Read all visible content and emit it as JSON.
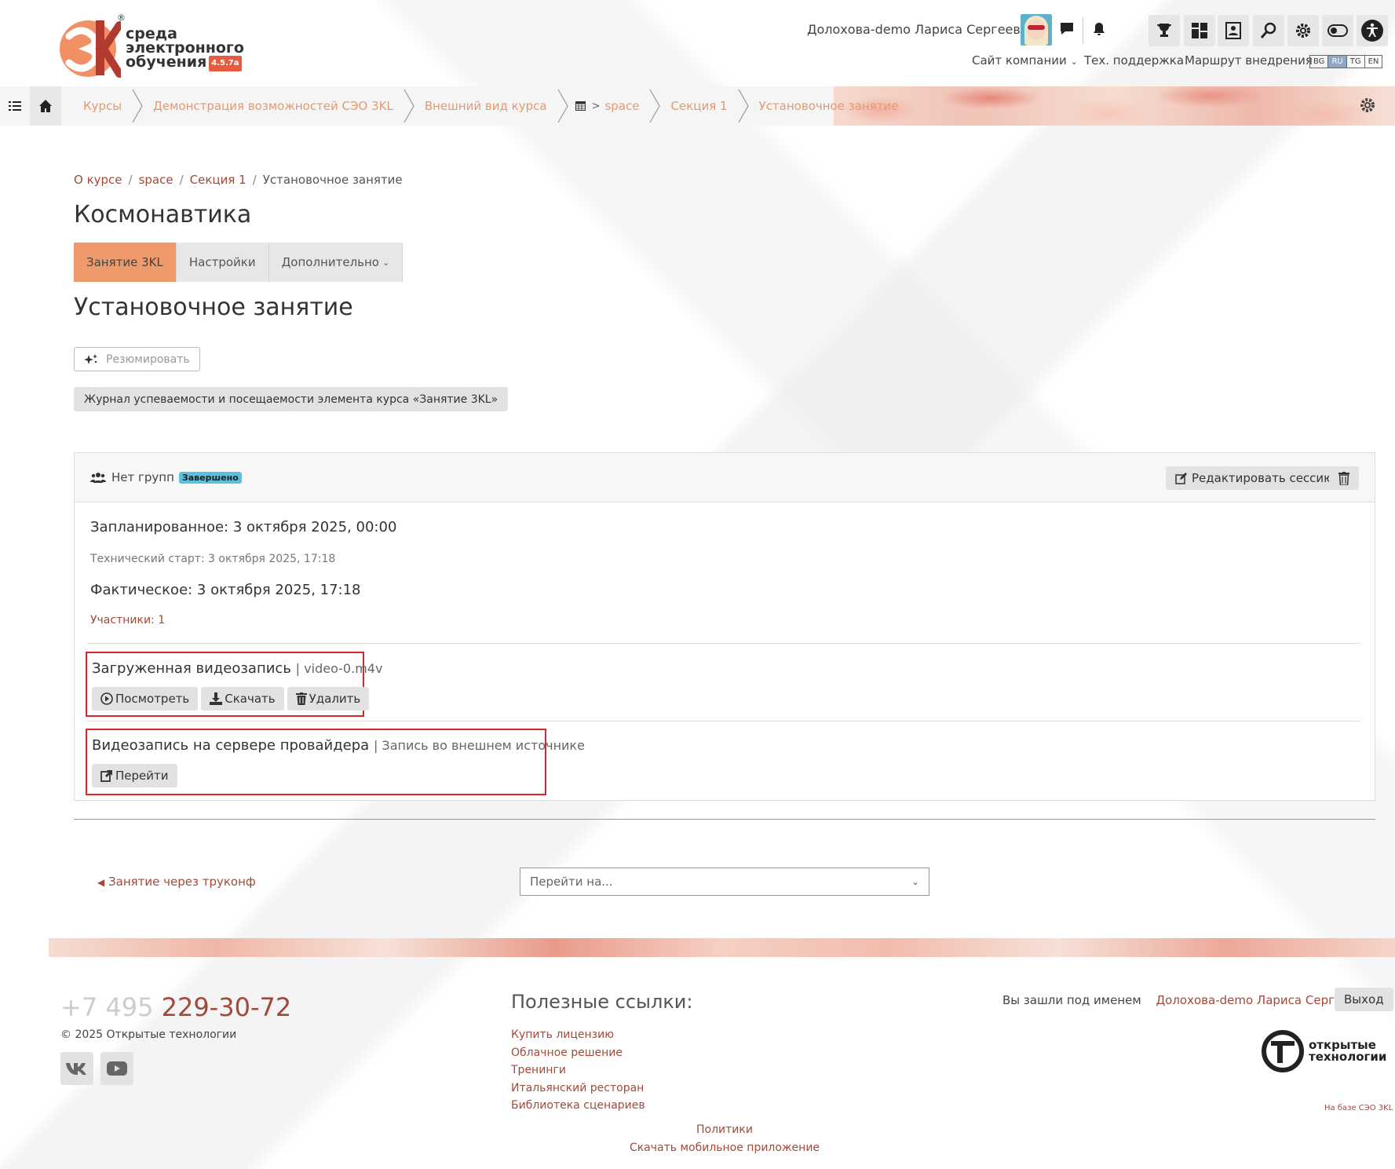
{
  "logo": {
    "line1": "среда",
    "line2": "электронного",
    "line3": "обучения",
    "version": "4.5.7a",
    "reg": "®"
  },
  "header": {
    "user_name": "Долохова-demo Лариса Сергеевна",
    "nav": {
      "company_site": "Сайт компании",
      "support": "Тех. поддержка",
      "route": "Маршрут внедрения"
    },
    "langs": [
      "BG",
      "RU",
      "TG",
      "EN"
    ],
    "active_lang": "RU"
  },
  "breadcrumb_bar": {
    "items": [
      "Курсы",
      "Демонстрация возможностей СЭО 3KL",
      "Внешний вид курса",
      "space",
      "Секция 1",
      "Установочное занятие"
    ]
  },
  "crumbs": {
    "items": [
      "О курсе",
      "space",
      "Секция 1"
    ],
    "current": "Установочное занятие"
  },
  "course_title": "Космонавтика",
  "tabs": {
    "t1": "Занятие 3KL",
    "t2": "Настройки",
    "t3": "Дополнительно"
  },
  "page_title": "Установочное занятие",
  "buttons": {
    "summarize": "Резюмировать",
    "journal": "Журнал успеваемости и посещаемости элемента курса «Занятие 3KL»"
  },
  "session": {
    "groups": "Нет групп",
    "status": "Завершено",
    "edit": "Редактировать сессию",
    "planned": "Запланированное: 3 октября 2025, 00:00",
    "tech_start": "Технический старт: 3 октября 2025, 17:18",
    "actual": "Фактическое: 3 октября 2025, 17:18",
    "participants": "Участники: 1",
    "uploaded": {
      "title": "Загруженная видеозапись",
      "file": "| video-0.m4v",
      "view": "Посмотреть",
      "download": "Скачать",
      "delete": "Удалить"
    },
    "provider": {
      "title": "Видеозапись на сервере провайдера",
      "sub": "| Запись во внешнем источнике",
      "go": "Перейти"
    }
  },
  "nav_bottom": {
    "prev": "Занятие через труконф",
    "goto_placeholder": "Перейти на..."
  },
  "footer": {
    "phone_code": "+7 495",
    "phone_number": "229-30-72",
    "copyright": "© 2025  Открытые технологии",
    "useful_title": "Полезные ссылки:",
    "links": [
      "Купить лицензию",
      "Облачное решение",
      "Тренинги",
      "Итальянский ресторан",
      "Библиотека сценариев"
    ],
    "policies": "Политики",
    "mobile_app": "Скачать мобильное приложение",
    "logged_in_as": "Вы зашли под именем",
    "logged_user": "Долохова-demo Лариса Сергеевна",
    "logout": "Выход",
    "ot_line1": "открытые",
    "ot_line2": "технологии",
    "based_on": "На базе СЭО 3KL"
  },
  "colors": {
    "accent": "#ee9a6b",
    "link": "#a3493a",
    "badge": "#5bc0de",
    "highlight_border": "#d9262c"
  }
}
